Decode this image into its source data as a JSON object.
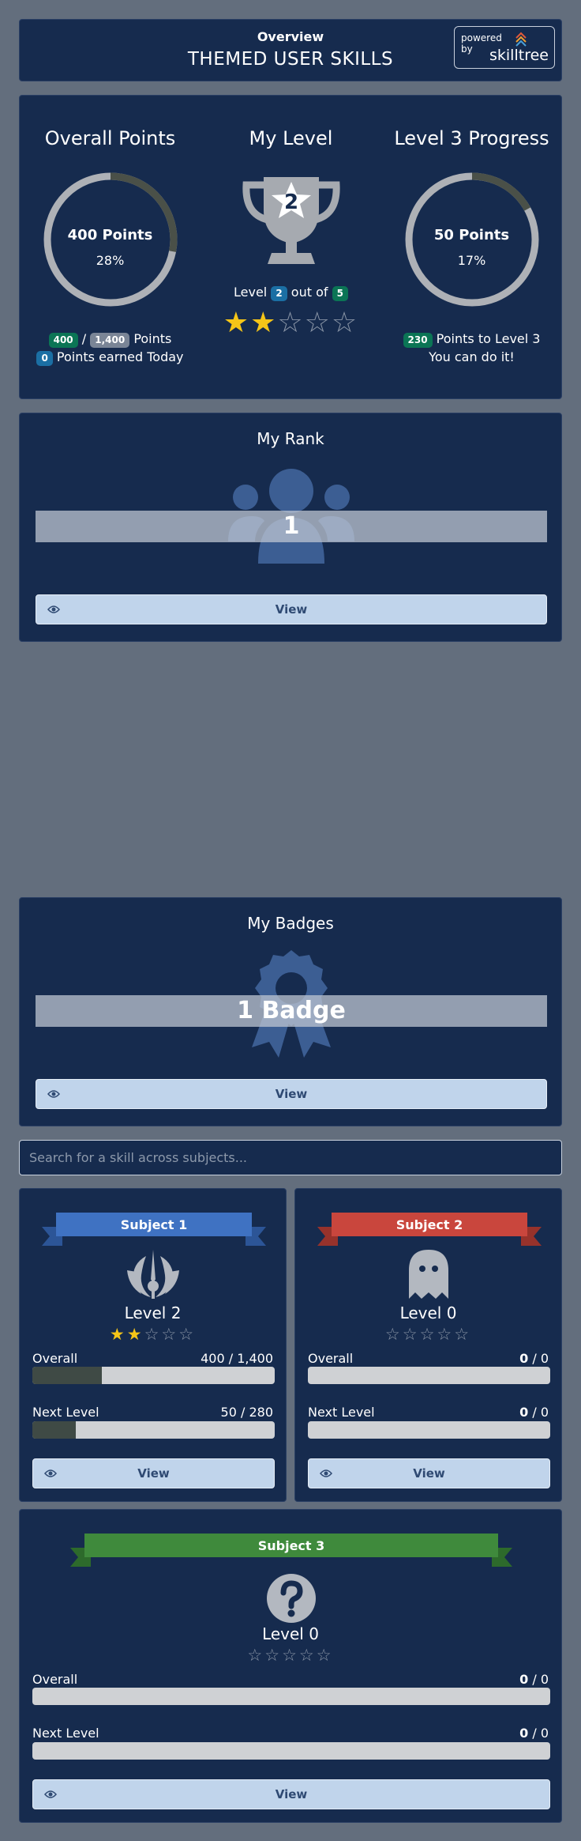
{
  "header": {
    "subtitle": "Overview",
    "title": "THEMED USER SKILLS",
    "powered_by": "powered\nby",
    "brand": "skilltree"
  },
  "summary": {
    "overall": {
      "title": "Overall Points",
      "points_text": "400 Points",
      "percent_text": "28%",
      "progress": 0.28,
      "earned": "400",
      "separator": "/",
      "total": "1,400",
      "points_word": "Points",
      "today_count": "0",
      "today_text": "Points earned Today"
    },
    "level": {
      "title": "My Level",
      "level_number": "2",
      "level_prefix": "Level",
      "level_value": "2",
      "out_of": "out of",
      "max_level": "5",
      "stars_filled": 2,
      "stars_total": 5
    },
    "progress": {
      "title": "Level 3 Progress",
      "points_text": "50 Points",
      "percent_text": "17%",
      "progress": 0.17,
      "remaining": "230",
      "remaining_text": "Points to Level 3",
      "encourage": "You can do it!"
    }
  },
  "rank": {
    "title": "My Rank",
    "value": "1",
    "icon": "users-icon",
    "view_label": "View"
  },
  "badges": {
    "title": "My Badges",
    "value": "1 Badge",
    "icon": "award-icon",
    "view_label": "View"
  },
  "search": {
    "placeholder": "Search for a skill across subjects..."
  },
  "subjects": [
    {
      "name": "Subject 1",
      "ribbon_color": "#3f72c2",
      "ribbon_dark": "#2c5597",
      "icon": "jedi-icon",
      "level": "Level 2",
      "stars_filled": 2,
      "overall_label": "Overall",
      "overall_value": "400 / 1,400",
      "overall_progress": 0.286,
      "next_label": "Next Level",
      "next_value": "50 / 280",
      "next_progress": 0.18,
      "view_label": "View"
    },
    {
      "name": "Subject 2",
      "ribbon_color": "#c9463d",
      "ribbon_dark": "#97322b",
      "icon": "ghost-icon",
      "level": "Level 0",
      "stars_filled": 0,
      "overall_label": "Overall",
      "overall_value_bold": "0",
      "overall_value_rest": " / 0",
      "overall_progress": 0,
      "next_label": "Next Level",
      "next_value_bold": "0",
      "next_value_rest": " / 0",
      "next_progress": 0,
      "view_label": "View"
    },
    {
      "name": "Subject 3",
      "ribbon_color": "#3f8a3c",
      "ribbon_dark": "#2d6a2b",
      "icon": "question-icon",
      "level": "Level 0",
      "stars_filled": 0,
      "overall_label": "Overall",
      "overall_value_bold": "0",
      "overall_value_rest": " / 0",
      "overall_progress": 0,
      "next_label": "Next Level",
      "next_value_bold": "0",
      "next_value_rest": " / 0",
      "next_progress": 0,
      "view_label": "View"
    }
  ],
  "colors": {
    "page_bg": "#636e7d",
    "card_bg": "#162b4e",
    "ring_track": "#aeb1b6",
    "ring_fill": "#4a5048",
    "button_bg": "#c0d4eb",
    "star": "#f5c518"
  }
}
